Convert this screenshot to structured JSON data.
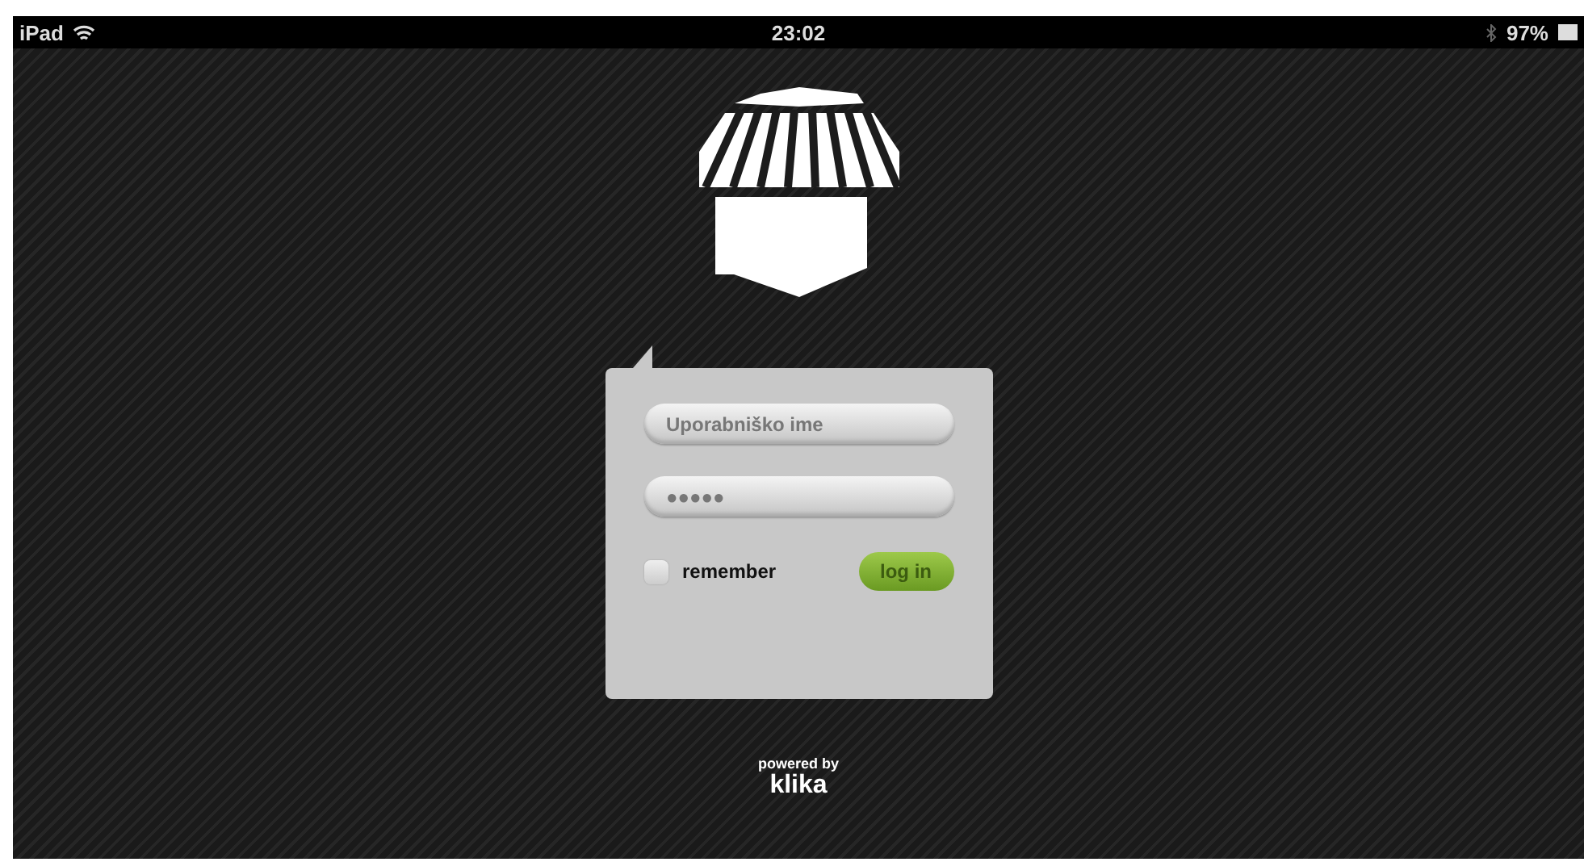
{
  "status_bar": {
    "device": "iPad",
    "time": "23:02",
    "battery": "97%"
  },
  "login": {
    "username": {
      "placeholder": "Uporabniško ime"
    },
    "password": {
      "value": "●●●●●"
    },
    "remember": {
      "label": "remember",
      "checked": false
    },
    "submit": "log in"
  },
  "footer": {
    "powered_by": "powered by",
    "brand": "klika"
  }
}
